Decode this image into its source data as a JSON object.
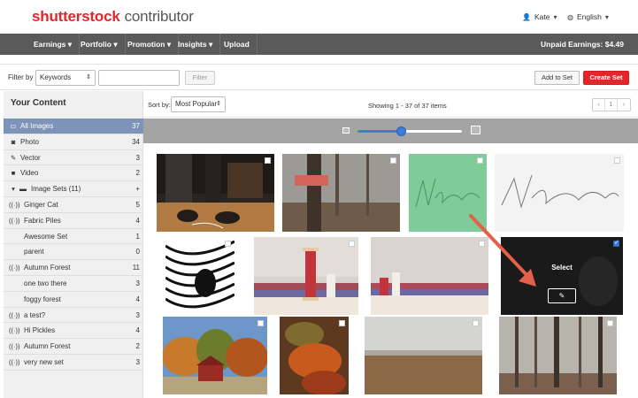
{
  "header": {
    "logo_brand": "shutterstock",
    "logo_sub": "contributor",
    "user": "Kate",
    "language": "English"
  },
  "nav": {
    "items": [
      "Earnings",
      "Portfolio",
      "Promotion",
      "Insights",
      "Upload"
    ],
    "unpaid": "Unpaid Earnings: $4.49"
  },
  "filter": {
    "label": "Filter by",
    "type": "Keywords",
    "input_value": "",
    "filter_button": "Filter",
    "add_to_set": "Add to Set",
    "create_set": "Create Set"
  },
  "sidebar": {
    "title": "Your Content",
    "items": [
      {
        "label": "All Images",
        "count": "37",
        "icon": "grid-icon"
      },
      {
        "label": "Photo",
        "count": "34",
        "icon": "camera-icon"
      },
      {
        "label": "Vector",
        "count": "3",
        "icon": "pen-icon"
      },
      {
        "label": "Video",
        "count": "2",
        "icon": "video-icon"
      },
      {
        "label": "Image Sets (11)",
        "count": "+",
        "icon": "folder-icon"
      },
      {
        "label": "Ginger Cat",
        "count": "5",
        "icon": "broadcast-icon"
      },
      {
        "label": "Fabric Piles",
        "count": "4",
        "icon": "broadcast-icon"
      },
      {
        "label": "Awesome Set",
        "count": "1",
        "icon": ""
      },
      {
        "label": "parent",
        "count": "0",
        "icon": ""
      },
      {
        "label": "Autumn Forest",
        "count": "11",
        "icon": "broadcast-icon"
      },
      {
        "label": "one two there",
        "count": "3",
        "icon": ""
      },
      {
        "label": "foggy forest",
        "count": "4",
        "icon": ""
      },
      {
        "label": "a test?",
        "count": "3",
        "icon": "broadcast-icon"
      },
      {
        "label": "Hi Pickles",
        "count": "4",
        "icon": "broadcast-icon"
      },
      {
        "label": "Autumn Forest",
        "count": "2",
        "icon": "broadcast-icon"
      },
      {
        "label": "very new set",
        "count": "3",
        "icon": "broadcast-icon"
      }
    ]
  },
  "content": {
    "sort_label": "Sort by:",
    "sort_value": "Most Popular",
    "showing": "Showing 1 - 37 of 37 items",
    "page": "1",
    "zoom_level": 0.42,
    "select_label": "Select"
  },
  "colors": {
    "brand_red": "#e3262b",
    "nav_bg": "#5a5a5a",
    "active_row": "#7d93b7",
    "accent_blue": "#3b7cd6",
    "arrow": "#e5604a"
  }
}
